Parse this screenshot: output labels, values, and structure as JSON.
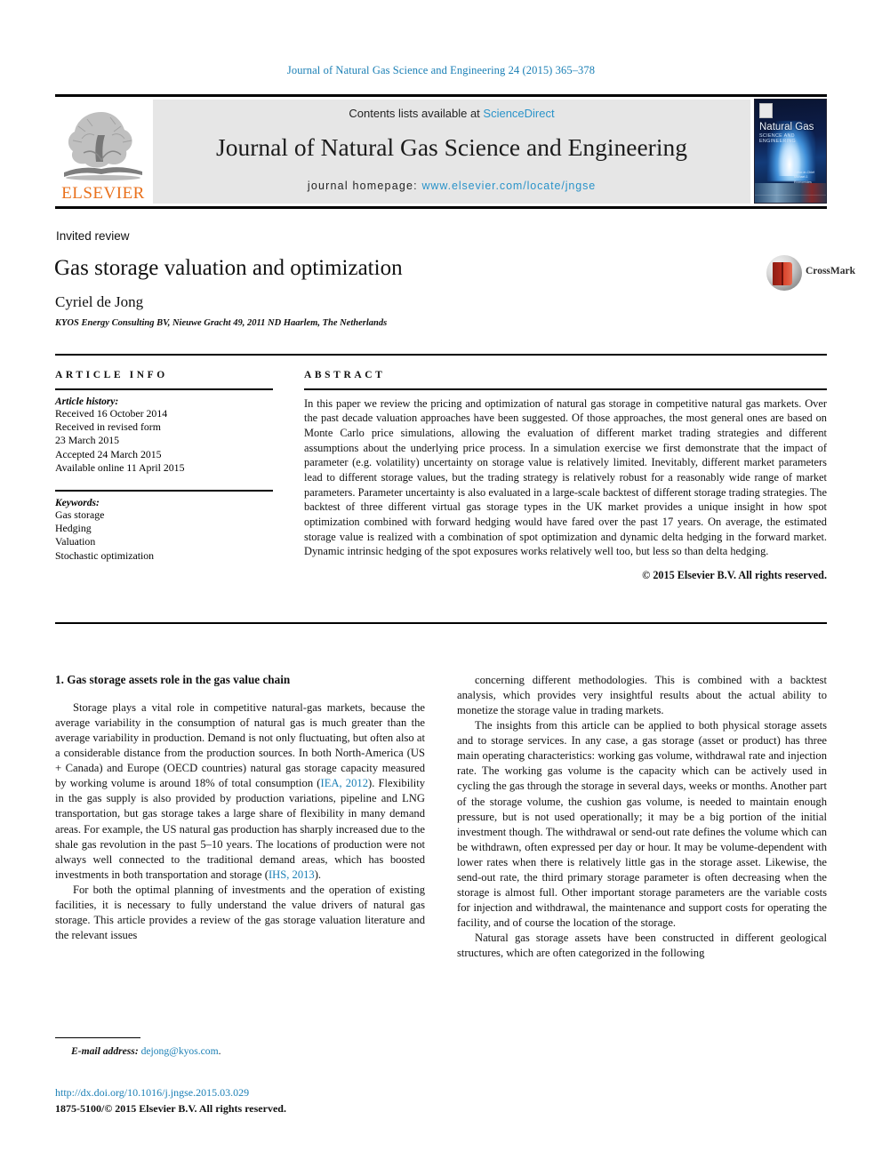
{
  "running_head": "Journal of Natural Gas Science and Engineering 24 (2015) 365–378",
  "masthead": {
    "contents_prefix": "Contents lists available at ",
    "sciencedirect": "ScienceDirect",
    "journal_title": "Journal of Natural Gas Science and Engineering",
    "homepage_prefix": "journal homepage: ",
    "homepage_url": "www.elsevier.com/locate/jngse",
    "publisher_wordmark": "ELSEVIER",
    "cover": {
      "title": "Natural Gas",
      "subtitle": "SCIENCE AND ENGINEERING",
      "authors": "Editor-in-Chief\nMichael J. Economides"
    }
  },
  "article": {
    "type": "Invited review",
    "title": "Gas storage valuation and optimization",
    "author": "Cyriel de Jong",
    "affiliation": "KYOS Energy Consulting BV, Nieuwe Gracht 49, 2011 ND Haarlem, The Netherlands",
    "crossmark_label": "CrossMark"
  },
  "article_info": {
    "heading": "ARTICLE INFO",
    "history_label": "Article history:",
    "history": [
      "Received 16 October 2014",
      "Received in revised form",
      "23 March 2015",
      "Accepted 24 March 2015",
      "Available online 11 April 2015"
    ],
    "keywords_label": "Keywords:",
    "keywords": [
      "Gas storage",
      "Hedging",
      "Valuation",
      "Stochastic optimization"
    ]
  },
  "abstract": {
    "heading": "ABSTRACT",
    "text": "In this paper we review the pricing and optimization of natural gas storage in competitive natural gas markets. Over the past decade valuation approaches have been suggested. Of those approaches, the most general ones are based on Monte Carlo price simulations, allowing the evaluation of different market trading strategies and different assumptions about the underlying price process. In a simulation exercise we first demonstrate that the impact of parameter (e.g. volatility) uncertainty on storage value is relatively limited. Inevitably, different market parameters lead to different storage values, but the trading strategy is relatively robust for a reasonably wide range of market parameters. Parameter uncertainty is also evaluated in a large-scale backtest of different storage trading strategies. The backtest of three different virtual gas storage types in the UK market provides a unique insight in how spot optimization combined with forward hedging would have fared over the past 17 years. On average, the estimated storage value is realized with a combination of spot optimization and dynamic delta hedging in the forward market. Dynamic intrinsic hedging of the spot exposures works relatively well too, but less so than delta hedging.",
    "copyright": "© 2015 Elsevier B.V. All rights reserved."
  },
  "body": {
    "section_heading": "1. Gas storage assets role in the gas value chain",
    "left_paragraphs": [
      {
        "pre": "Storage plays a vital role in competitive natural-gas markets, because the average variability in the consumption of natural gas is much greater than the average variability in production. Demand is not only fluctuating, but often also at a considerable distance from the production sources. In both North-America (US + Canada) and Europe (OECD countries) natural gas storage capacity measured by working volume is around 18% of total consumption (",
        "ref": "IEA, 2012",
        "mid": "). Flexibility in the gas supply is also provided by production variations, pipeline and LNG transportation, but gas storage takes a large share of flexibility in many demand areas. For example, the US natural gas production has sharply increased due to the shale gas revolution in the past 5–10 years. The locations of production were not always well connected to the traditional demand areas, which has boosted investments in both transportation and storage (",
        "ref2": "IHS, 2013",
        "post": ")."
      },
      {
        "pre": "For both the optimal planning of investments and the operation of existing facilities, it is necessary to fully understand the value drivers of natural gas storage. This article provides a review of the gas storage valuation literature and the relevant issues"
      }
    ],
    "right_paragraphs": [
      "concerning different methodologies. This is combined with a backtest analysis, which provides very insightful results about the actual ability to monetize the storage value in trading markets.",
      "The insights from this article can be applied to both physical storage assets and to storage services. In any case, a gas storage (asset or product) has three main operating characteristics: working gas volume, withdrawal rate and injection rate. The working gas volume is the capacity which can be actively used in cycling the gas through the storage in several days, weeks or months. Another part of the storage volume, the cushion gas volume, is needed to maintain enough pressure, but is not used operationally; it may be a big portion of the initial investment though. The withdrawal or send-out rate defines the volume which can be withdrawn, often expressed per day or hour. It may be volume-dependent with lower rates when there is relatively little gas in the storage asset. Likewise, the send-out rate, the third primary storage parameter is often decreasing when the storage is almost full. Other important storage parameters are the variable costs for injection and withdrawal, the maintenance and support costs for operating the facility, and of course the location of the storage.",
      "Natural gas storage assets have been constructed in different geological structures, which are often categorized in the following"
    ]
  },
  "footer": {
    "email_label": "E-mail address:",
    "email": "dejong@kyos.com",
    "email_suffix": ".",
    "doi": "http://dx.doi.org/10.1016/j.jngse.2015.03.029",
    "issn_line": "1875-5100/© 2015 Elsevier B.V. All rights reserved."
  },
  "colors": {
    "link": "#1a7fb5",
    "sciencedirect": "#2a93c9",
    "elsevier_orange": "#E9711C",
    "band": "#e6e6e6"
  }
}
